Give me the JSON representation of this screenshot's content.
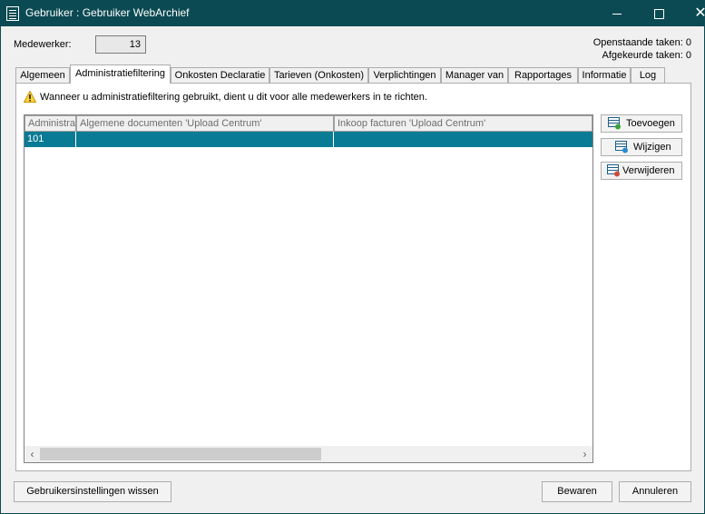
{
  "window": {
    "title": "Gebruiker : Gebruiker WebArchief",
    "minimize_glyph": "",
    "maximize_glyph": "",
    "close_glyph": "✕"
  },
  "header": {
    "employee_label": "Medewerker:",
    "employee_value": "13",
    "open_tasks": "Openstaande taken: 0",
    "rejected_tasks": "Afgekeurde taken: 0"
  },
  "tabs": [
    {
      "label": "Algemeen"
    },
    {
      "label": "Administratiefiltering"
    },
    {
      "label": "Onkosten Declaratie"
    },
    {
      "label": "Tarieven (Onkosten)"
    },
    {
      "label": "Verplichtingen"
    },
    {
      "label": "Manager van"
    },
    {
      "label": "Rapportages"
    },
    {
      "label": "Informatie"
    },
    {
      "label": "Log"
    }
  ],
  "active_tab": "Administratiefiltering",
  "warning": {
    "icon": "warning-icon",
    "text": "Wanneer u administratiefiltering gebruikt, dient u dit voor alle medewerkers in te richten."
  },
  "grid": {
    "columns": [
      "Administra",
      "Algemene documenten 'Upload Centrum'",
      "Inkoop facturen 'Upload Centrum'"
    ],
    "rows": [
      [
        "101",
        "",
        ""
      ]
    ],
    "selected_row_color": "#0a7b94",
    "scroll_left_glyph": "‹",
    "scroll_right_glyph": "›"
  },
  "side_buttons": {
    "add": "Toevoegen",
    "edit": "Wijzigen",
    "delete": "Verwijderen"
  },
  "footer": {
    "reset_label": "Gebruikersinstellingen wissen",
    "save_label": "Bewaren",
    "cancel_label": "Annuleren"
  }
}
